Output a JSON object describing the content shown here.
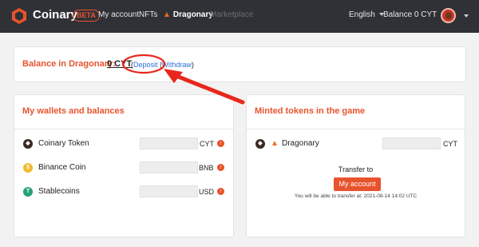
{
  "nav": {
    "brand": "Coinary",
    "beta": "BETA",
    "links": [
      "My account",
      "NFTs",
      "Dragonary",
      "Marketplace"
    ],
    "language": "English",
    "balance": "Balance 0 CYT"
  },
  "balance": {
    "title": "Balance in Dragonary:",
    "value": "0 CYT",
    "open_paren": "(",
    "deposit": "Deposit",
    "separator": " |",
    "withdraw": "Withdraw",
    "close_paren": ")"
  },
  "wallets": {
    "title": "My wallets and balances",
    "rows": [
      {
        "name": "Coinary Token",
        "unit": "CYT",
        "icon": "coinary-token-icon",
        "color": "#3b2a26"
      },
      {
        "name": "Binance Coin",
        "unit": "BNB",
        "icon": "binance-coin-icon",
        "color": "#f3ba2f"
      },
      {
        "name": "Stablecoins",
        "unit": "USD",
        "icon": "stablecoin-icon",
        "color": "#26a17b"
      }
    ]
  },
  "minted": {
    "title": "Minted tokens in the game",
    "row": {
      "name": "Dragonary",
      "unit": "CYT"
    },
    "transfer_label": "Transfer to",
    "button": "My account",
    "note": "You will be able to transfer at: 2021-08-14 14:02 UTC"
  },
  "colors": {
    "accent": "#e8532d",
    "nav_bg": "#2f3136",
    "link": "#2a6fd6"
  }
}
